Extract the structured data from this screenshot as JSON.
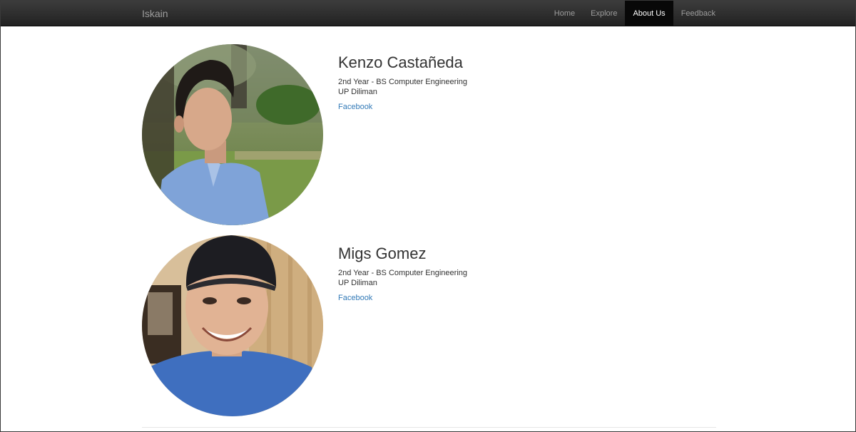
{
  "nav": {
    "brand": "Iskain",
    "items": [
      {
        "label": "Home",
        "active": false
      },
      {
        "label": "Explore",
        "active": false
      },
      {
        "label": "About Us",
        "active": true
      },
      {
        "label": "Feedback",
        "active": false
      }
    ]
  },
  "members": [
    {
      "name": "Kenzo Castañeda",
      "year_program": "2nd Year - BS Computer Engineering",
      "school": "UP Diliman",
      "link_label": "Facebook"
    },
    {
      "name": "Migs Gomez",
      "year_program": "2nd Year - BS Computer Engineering",
      "school": "UP Diliman",
      "link_label": "Facebook"
    }
  ],
  "colors": {
    "navbar": "#222222",
    "nav_active": "#080808",
    "link": "#337ab7",
    "text": "#333333"
  }
}
